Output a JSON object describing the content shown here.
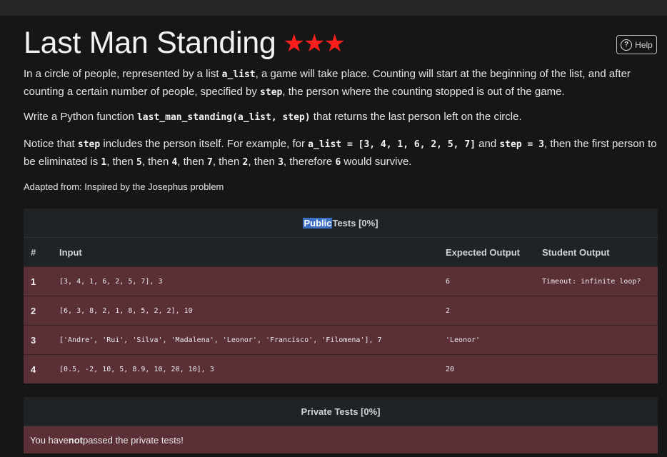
{
  "title": "Last Man Standing",
  "stars": "★★★",
  "help_label": "Help",
  "description": {
    "p1": {
      "t1": "In a circle of people, represented by a list ",
      "c1": "a_list",
      "t2": ", a game will take place. Counting will start at the beginning of the list, and after counting a certain number of people, specified by ",
      "c2": "step",
      "t3": ", the person where the counting stopped is out of the game."
    },
    "p2": {
      "t1": "Write a Python function ",
      "c1": "last_man_standing(a_list, step)",
      "t2": " that returns the last person left on the circle."
    },
    "p3": {
      "t1": "Notice that ",
      "c1": "step",
      "t2": " includes the person itself. For example, for ",
      "c2": "a_list = [3, 4, 1, 6, 2, 5, 7]",
      "t3": " and ",
      "c3": "step = 3",
      "t4": ", then the first person to be eliminated is ",
      "c4": "1",
      "t5": ", then ",
      "c5": "5",
      "t6": ", then ",
      "c6": "4",
      "t7": ", then ",
      "c7": "7",
      "t8": ", then ",
      "c8": "2",
      "t9": ", then ",
      "c9": "3",
      "t10": ", therefore ",
      "c10": "6",
      "t11": " would survive."
    }
  },
  "adapted": "Adapted from: Inspired by the Josephus problem",
  "public_tests": {
    "title_highlight": "Public",
    "title_rest": " Tests [0%]",
    "columns": [
      "#",
      "Input",
      "Expected Output",
      "Student Output"
    ],
    "rows": [
      {
        "num": "1",
        "input": "[3, 4, 1, 6, 2, 5, 7], 3",
        "expected": "6",
        "student": "Timeout: infinite loop?"
      },
      {
        "num": "2",
        "input": "[6, 3, 8, 2, 1, 8, 5, 2, 2], 10",
        "expected": "2",
        "student": ""
      },
      {
        "num": "3",
        "input": "['Andre', 'Rui', 'Silva', 'Madalena', 'Leonor', 'Francisco', 'Filomena'], 7",
        "expected": "'Leonor'",
        "student": ""
      },
      {
        "num": "4",
        "input": "[0.5, -2, 10, 5, 8.9, 10, 20, 10], 3",
        "expected": "20",
        "student": ""
      }
    ]
  },
  "private_tests": {
    "title": "Private Tests [0%]",
    "msg_pre": "You have ",
    "msg_bold": "not",
    "msg_post": " passed the private tests!"
  }
}
